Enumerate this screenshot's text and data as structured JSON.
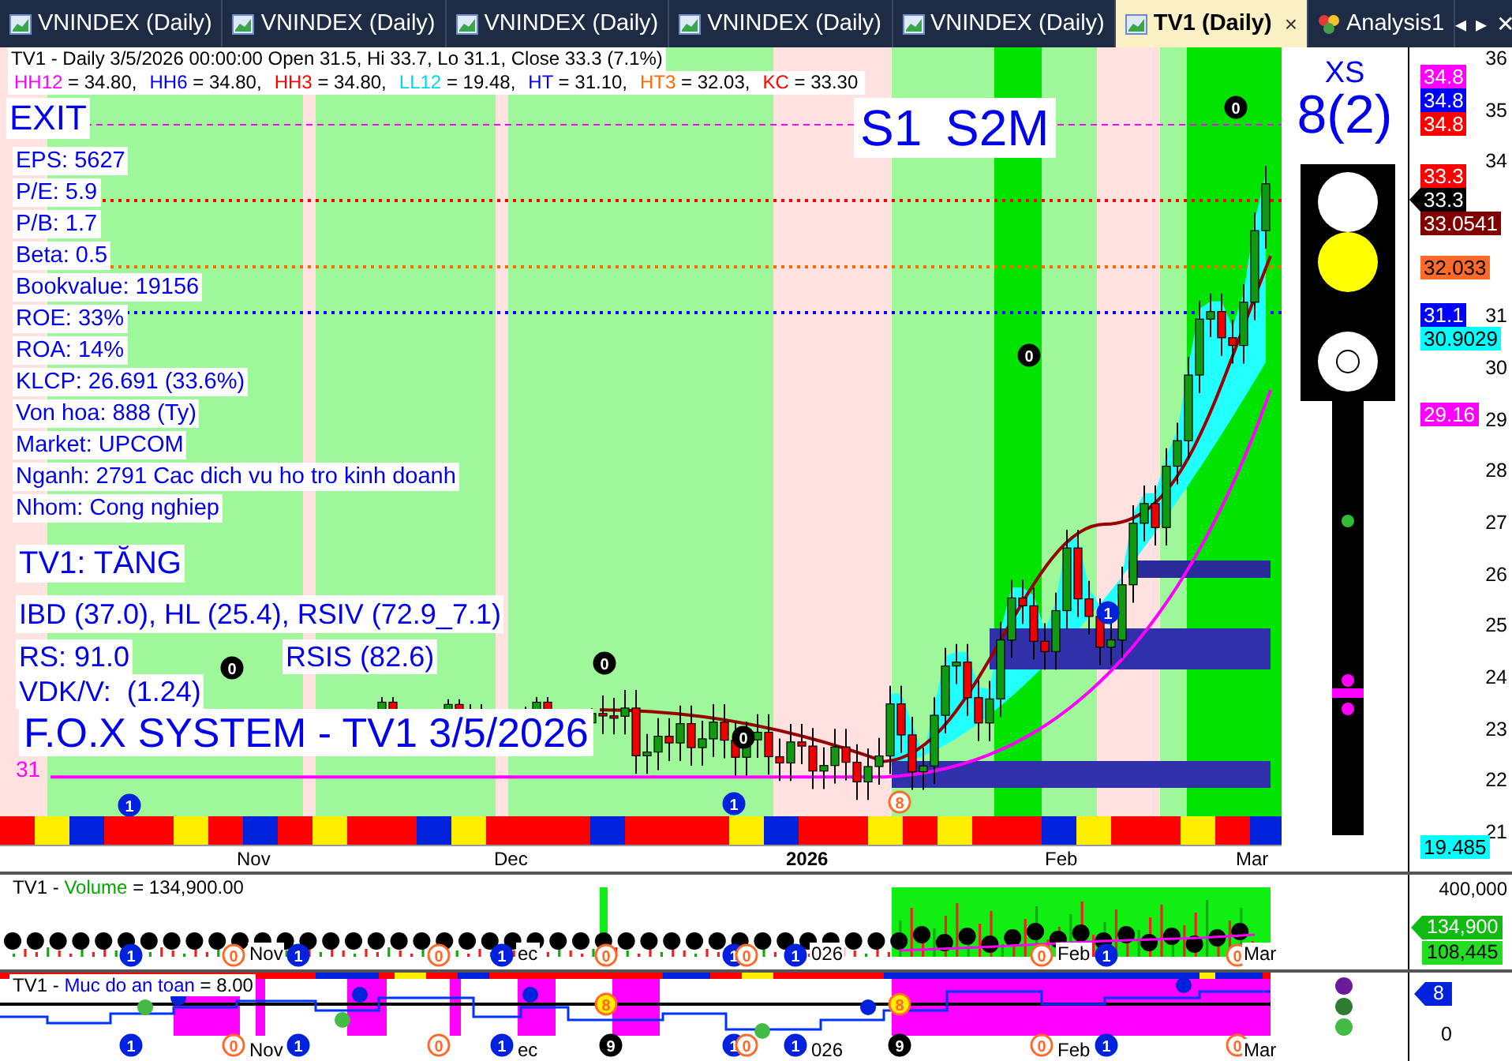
{
  "tabs": [
    {
      "label": "VNINDEX (Daily)",
      "selected": false,
      "kind": "chart"
    },
    {
      "label": "VNINDEX (Daily)",
      "selected": false,
      "kind": "chart"
    },
    {
      "label": "VNINDEX (Daily)",
      "selected": false,
      "kind": "chart"
    },
    {
      "label": "VNINDEX (Daily)",
      "selected": false,
      "kind": "chart"
    },
    {
      "label": "VNINDEX (Daily)",
      "selected": false,
      "kind": "chart"
    },
    {
      "label": "TV1 (Daily)",
      "selected": true,
      "kind": "chart",
      "close": "×"
    },
    {
      "label": "Analysis1",
      "selected": false,
      "kind": "analysis"
    }
  ],
  "tab_nav": [
    "◂",
    "▸",
    "✕"
  ],
  "main_chart": {
    "header": "TV1 - Daily 3/5/2026 00:00:00 Open 31.5, Hi 33.7, Lo 31.1, Close 33.3 (7.1%)",
    "levels": [
      {
        "label": "HH12",
        "value": "= 34.80,",
        "color": "#ff00ff"
      },
      {
        "label": "HH6",
        "value": "= 34.80,",
        "color": "#0000ff"
      },
      {
        "label": "HH3",
        "value": "= 34.80,",
        "color": "#ff0000"
      },
      {
        "label": "LL12",
        "value": "= 19.48,",
        "color": "#00d8e8"
      },
      {
        "label": "HT",
        "value": "= 31.10,",
        "color": "#0000ff"
      },
      {
        "label": "HT3",
        "value": "= 32.03,",
        "color": "#ff6a00"
      },
      {
        "label": "KC",
        "value": "= 33.30",
        "color": "#ff0000"
      }
    ],
    "signal": "EXIT",
    "pattern": "S1 S2M",
    "fundamentals": [
      "EPS: 5627",
      "P/E: 5.9",
      "P/B: 1.7",
      "Beta: 0.5",
      "Bookvalue: 19156",
      "ROE: 33%",
      "ROA: 14%",
      "KLCP: 26.691 (33.6%)",
      "Von hoa: 888 (Ty)",
      "Market: UPCOM",
      "Nganh: 2791 Cac dich vu ho tro kinh doanh",
      "Nhom: Cong nghiep"
    ],
    "trend": "TV1: TĂNG",
    "ratings": "IBD (37.0), HL (25.4), RSIV (72.9_7.1)",
    "rs": "RS: 91.0",
    "rsis": "RSIS (82.6)",
    "vdk": "VDK/V:  (1.24)",
    "system_title": "F.O.X SYSTEM - TV1 3/5/2026",
    "count": "31",
    "markers": [
      {
        "label": "1",
        "kind": "blue"
      },
      {
        "label": "0",
        "kind": "black"
      },
      {
        "label": "0",
        "kind": "black"
      },
      {
        "label": "0",
        "kind": "black"
      },
      {
        "label": "1",
        "kind": "blue"
      },
      {
        "label": "0",
        "kind": "black"
      },
      {
        "label": "1",
        "kind": "blue"
      },
      {
        "label": "0",
        "kind": "black"
      },
      {
        "label": "8",
        "kind": "orange"
      }
    ],
    "x_labels": [
      "Nov",
      "Dec",
      "2026",
      "Feb",
      "Mar"
    ]
  },
  "signal_panel": {
    "label": "XS",
    "score": "8(2)",
    "lights": [
      {
        "color": "#ffffff",
        "ring": false
      },
      {
        "color": "#ffff00",
        "ring": false
      },
      {
        "color": "#ffffff",
        "ring": true
      }
    ],
    "dots": [
      {
        "color": "#33bb33"
      },
      {
        "color": "#ff00ff"
      },
      {
        "color": "#ff00ff"
      }
    ]
  },
  "price_axis": {
    "tags": [
      {
        "value": "34.8",
        "color": "#ff00ff",
        "pointer": false
      },
      {
        "value": "34.8",
        "color": "#0000ff",
        "pointer": false
      },
      {
        "value": "34.8",
        "color": "#ff0000",
        "pointer": false
      },
      {
        "value": "33.3",
        "color": "#ff0000",
        "pointer": false
      },
      {
        "value": "33.3",
        "color": "#000000",
        "pointer": true
      },
      {
        "value": "33.0541",
        "color": "#800000",
        "pointer": false
      },
      {
        "value": "32.033",
        "color": "#ff6a2a",
        "pointer": false
      },
      {
        "value": "31.1",
        "color": "#0000ff",
        "pointer": false
      },
      {
        "value": "30.9029",
        "color": "#00ffff",
        "pointer": false
      },
      {
        "value": "29.16",
        "color": "#ff00ff",
        "pointer": false
      },
      {
        "value": "19.485",
        "color": "#00ffff",
        "pointer": false
      }
    ],
    "ticks": [
      "36",
      "35",
      "34",
      "31",
      "30",
      "29",
      "28",
      "27",
      "26",
      "25",
      "24",
      "23",
      "22",
      "21"
    ]
  },
  "volume_panel": {
    "prefix": "TV1 -",
    "name": "Volume",
    "value": "= 134,900.00",
    "markers": [
      {
        "label": "1",
        "kind": "blue"
      },
      {
        "label": "0",
        "kind": "orange"
      },
      {
        "label": "1",
        "kind": "blue"
      },
      {
        "label": "0",
        "kind": "orange"
      },
      {
        "label": "1",
        "kind": "blue"
      },
      {
        "label": "0",
        "kind": "orange"
      },
      {
        "label": "1",
        "kind": "blue"
      },
      {
        "label": "0",
        "kind": "orange"
      },
      {
        "label": "1",
        "kind": "blue"
      },
      {
        "label": "0",
        "kind": "orange"
      },
      {
        "label": "1",
        "kind": "blue"
      },
      {
        "label": "0",
        "kind": "orange"
      }
    ],
    "x_labels": [
      "Nov",
      "ec",
      "026",
      "Feb",
      "Mar"
    ],
    "ticks": [
      "400,000"
    ],
    "tags": [
      {
        "value": "134,900",
        "pointer": true
      },
      {
        "value": "108,445",
        "pointer": false
      }
    ]
  },
  "safety_panel": {
    "prefix": "TV1 -",
    "name": "Muc do an toan",
    "value": "= 8.00",
    "markers": [
      {
        "label": "8",
        "kind": "yellow"
      },
      {
        "label": "8",
        "kind": "yellow"
      },
      {
        "label": "1",
        "kind": "blue"
      },
      {
        "label": "0",
        "kind": "orange"
      },
      {
        "label": "1",
        "kind": "blue"
      },
      {
        "label": "0",
        "kind": "orange"
      },
      {
        "label": "1",
        "kind": "blue"
      },
      {
        "label": "9",
        "kind": "black"
      },
      {
        "label": "1",
        "kind": "blue"
      },
      {
        "label": "0",
        "kind": "orange"
      },
      {
        "label": "1",
        "kind": "blue"
      },
      {
        "label": "9",
        "kind": "black"
      },
      {
        "label": "0",
        "kind": "orange"
      },
      {
        "label": "1",
        "kind": "blue"
      },
      {
        "label": "0",
        "kind": "orange"
      }
    ],
    "x_labels": [
      "Nov",
      "ec",
      "026",
      "Feb",
      "Mar"
    ],
    "dots": [
      {
        "color": "#6a1b9a"
      },
      {
        "color": "#2e7d32"
      },
      {
        "color": "#44bb44"
      }
    ],
    "tag": "8",
    "ticks": [
      "0"
    ]
  }
}
